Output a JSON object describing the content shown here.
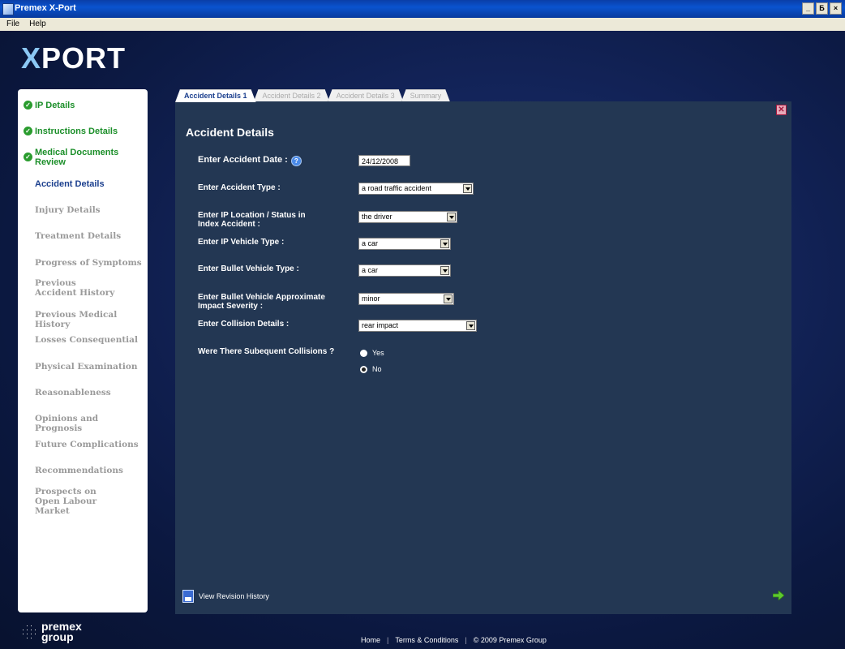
{
  "window": {
    "title": "Premex X-Port",
    "controls": [
      "_",
      "×"
    ],
    "restore_label": "Б"
  },
  "menu": {
    "items": [
      "File",
      "Help"
    ]
  },
  "logo": {
    "x": "X",
    "rest": "PORT"
  },
  "sidebar": {
    "items": [
      {
        "label": "IP Details",
        "state": "done"
      },
      {
        "label": "Instructions Details",
        "state": "done"
      },
      {
        "label": "Medical Documents Review",
        "state": "done"
      },
      {
        "label": "Accident Details",
        "state": "active"
      },
      {
        "label": "Injury Details",
        "state": "pending"
      },
      {
        "label": "Treatment Details",
        "state": "pending"
      },
      {
        "label": "Progress of Symptoms",
        "state": "pending"
      },
      {
        "label": "Previous Accident History",
        "state": "pending"
      },
      {
        "label": "Previous Medical History",
        "state": "pending"
      },
      {
        "label": "Losses Consequential",
        "state": "pending"
      },
      {
        "label": "Physical Examination",
        "state": "pending"
      },
      {
        "label": "Reasonableness",
        "state": "pending"
      },
      {
        "label": "Opinions and Prognosis",
        "state": "pending"
      },
      {
        "label": "Future Complications",
        "state": "pending"
      },
      {
        "label": "Recommendations",
        "state": "pending"
      },
      {
        "label": "Prospects on Open Labour Market",
        "state": "pending"
      }
    ]
  },
  "tabs": [
    {
      "label": "Accident Details 1",
      "active": true
    },
    {
      "label": "Accident Details 2",
      "active": false
    },
    {
      "label": "Accident Details 3",
      "active": false
    },
    {
      "label": "Summary",
      "active": false
    }
  ],
  "panel": {
    "title": "Accident Details",
    "fields": {
      "date_label": "Enter Accident Date :",
      "date_value": "24/12/2008",
      "type_label": "Enter Accident Type :",
      "type_value": "a road traffic accident",
      "location_label": "Enter IP Location / Status in Index Accident :",
      "location_value": "the driver",
      "ip_vehicle_label": "Enter IP Vehicle Type :",
      "ip_vehicle_value": "a car",
      "bullet_vehicle_label": "Enter Bullet Vehicle Type :",
      "bullet_vehicle_value": "a car",
      "severity_label": "Enter Bullet Vehicle Approximate Impact Severity :",
      "severity_value": "minor",
      "collision_label": "Enter Collision Details :",
      "collision_value": "rear impact",
      "subsequent_label": "Were There Subequent Collisions ?",
      "yes_label": "Yes",
      "no_label": "No",
      "selected": "No"
    },
    "revision_label": "View Revision History"
  },
  "brand": {
    "line1": "premex",
    "line2": "group"
  },
  "footer": {
    "home": "Home",
    "sep": "|",
    "terms": "Terms & Conditions",
    "copyright": "© 2009 Premex Group"
  }
}
